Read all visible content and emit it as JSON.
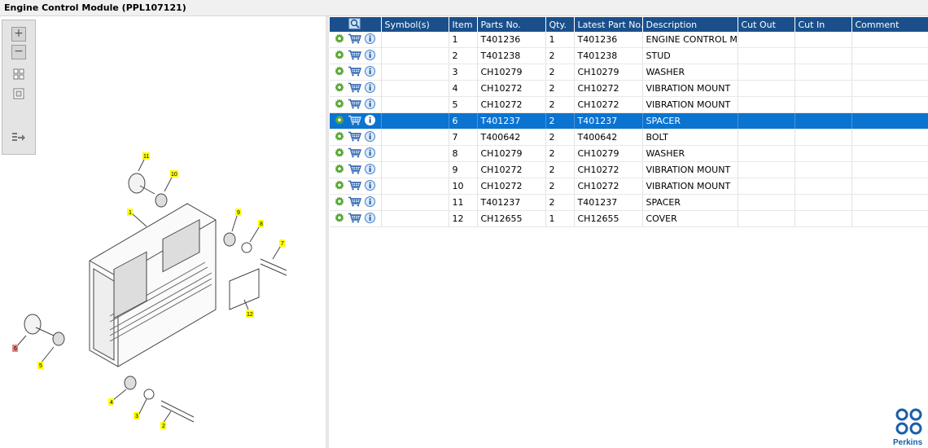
{
  "window": {
    "title": "Engine Control Module (PPL107121)"
  },
  "toolbar": {
    "zoom_in": "+",
    "zoom_out": "−",
    "fit_icon": "fit-all-icon",
    "reset_icon": "reset-view-icon",
    "export_icon": "export-icon"
  },
  "grid": {
    "headers": [
      "",
      "Symbol(s)",
      "Item",
      "Parts No.",
      "Qty.",
      "Latest Part No.",
      "Description",
      "Cut Out",
      "Cut In",
      "Comment"
    ],
    "selected_row": 6,
    "rows": [
      {
        "symbols": "",
        "item": "1",
        "part_no": "T401236",
        "qty": "1",
        "latest": "T401236",
        "desc": "ENGINE CONTROL MC",
        "cut_out": "",
        "cut_in": "",
        "comment": ""
      },
      {
        "symbols": "",
        "item": "2",
        "part_no": "T401238",
        "qty": "2",
        "latest": "T401238",
        "desc": "STUD",
        "cut_out": "",
        "cut_in": "",
        "comment": ""
      },
      {
        "symbols": "",
        "item": "3",
        "part_no": "CH10279",
        "qty": "2",
        "latest": "CH10279",
        "desc": "WASHER",
        "cut_out": "",
        "cut_in": "",
        "comment": ""
      },
      {
        "symbols": "",
        "item": "4",
        "part_no": "CH10272",
        "qty": "2",
        "latest": "CH10272",
        "desc": "VIBRATION MOUNT",
        "cut_out": "",
        "cut_in": "",
        "comment": ""
      },
      {
        "symbols": "",
        "item": "5",
        "part_no": "CH10272",
        "qty": "2",
        "latest": "CH10272",
        "desc": "VIBRATION MOUNT",
        "cut_out": "",
        "cut_in": "",
        "comment": ""
      },
      {
        "symbols": "",
        "item": "6",
        "part_no": "T401237",
        "qty": "2",
        "latest": "T401237",
        "desc": "SPACER",
        "cut_out": "",
        "cut_in": "",
        "comment": ""
      },
      {
        "symbols": "",
        "item": "7",
        "part_no": "T400642",
        "qty": "2",
        "latest": "T400642",
        "desc": "BOLT",
        "cut_out": "",
        "cut_in": "",
        "comment": ""
      },
      {
        "symbols": "",
        "item": "8",
        "part_no": "CH10279",
        "qty": "2",
        "latest": "CH10279",
        "desc": "WASHER",
        "cut_out": "",
        "cut_in": "",
        "comment": ""
      },
      {
        "symbols": "",
        "item": "9",
        "part_no": "CH10272",
        "qty": "2",
        "latest": "CH10272",
        "desc": "VIBRATION MOUNT",
        "cut_out": "",
        "cut_in": "",
        "comment": ""
      },
      {
        "symbols": "",
        "item": "10",
        "part_no": "CH10272",
        "qty": "2",
        "latest": "CH10272",
        "desc": "VIBRATION MOUNT",
        "cut_out": "",
        "cut_in": "",
        "comment": ""
      },
      {
        "symbols": "",
        "item": "11",
        "part_no": "T401237",
        "qty": "2",
        "latest": "T401237",
        "desc": "SPACER",
        "cut_out": "",
        "cut_in": "",
        "comment": ""
      },
      {
        "symbols": "",
        "item": "12",
        "part_no": "CH12655",
        "qty": "1",
        "latest": "CH12655",
        "desc": "COVER",
        "cut_out": "",
        "cut_in": "",
        "comment": ""
      }
    ],
    "row_icons": [
      "settings-gear-icon",
      "cart-icon",
      "info-icon"
    ]
  },
  "diagram": {
    "callouts": [
      {
        "label": "11",
        "highlight": false
      },
      {
        "label": "10",
        "highlight": false
      },
      {
        "label": "1",
        "highlight": false
      },
      {
        "label": "9",
        "highlight": false
      },
      {
        "label": "8",
        "highlight": false
      },
      {
        "label": "7",
        "highlight": false
      },
      {
        "label": "12",
        "highlight": false
      },
      {
        "label": "6",
        "highlight": true
      },
      {
        "label": "5",
        "highlight": false
      },
      {
        "label": "4",
        "highlight": false
      },
      {
        "label": "3",
        "highlight": false
      },
      {
        "label": "2",
        "highlight": false
      }
    ],
    "callout_color": "#ffff00",
    "highlight_color": "#f08080"
  },
  "brand": {
    "name": "Perkins",
    "color": "#1a5ea8"
  },
  "colors": {
    "header": "#1a4f8b",
    "selection": "#0b73d0",
    "gear": "#5aa832",
    "cart": "#2f66b3",
    "info": "#3f7fd1"
  }
}
